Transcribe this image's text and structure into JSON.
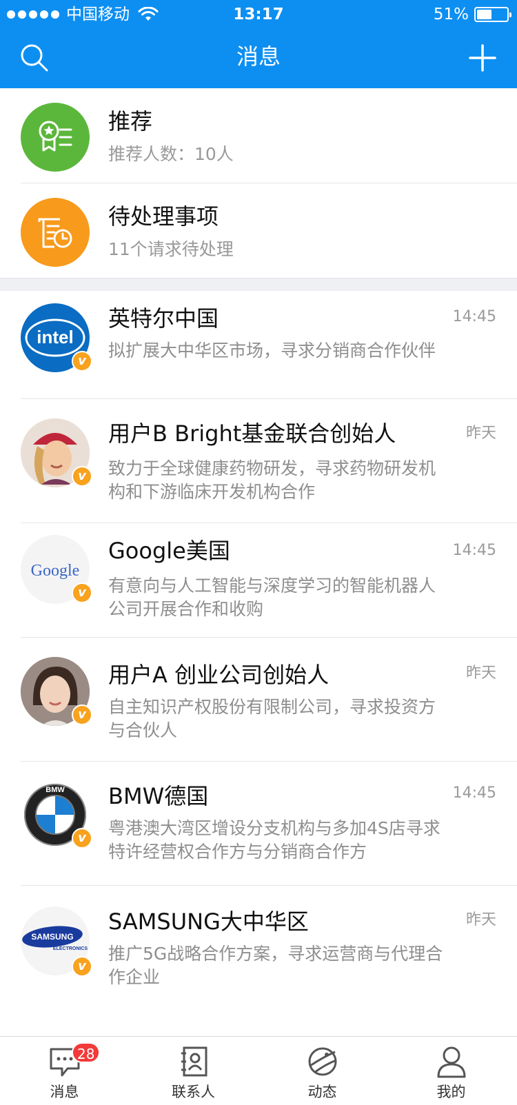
{
  "status_bar": {
    "carrier": "中国移动",
    "time": "13:17",
    "battery": "51%"
  },
  "nav": {
    "title": "消息",
    "icons": [
      "search-icon",
      "plus-icon"
    ]
  },
  "featured": [
    {
      "title": "推荐",
      "subtitle": "推荐人数：10人",
      "icon": "award-icon",
      "color": "#5bb73b"
    },
    {
      "title": "待处理事项",
      "subtitle": "11个请求待处理",
      "icon": "pending-doc-icon",
      "color": "#f89a1b"
    }
  ],
  "messages": [
    {
      "name": "英特尔中国",
      "time": "14:45",
      "preview": "拟扩展大中华区市场，寻求分销商合作伙伴",
      "avatar": "intel-logo",
      "verified_badge": "v"
    },
    {
      "name": "用户B   Bright基金联合创始人",
      "time": "昨天",
      "preview": "致力于全球健康药物研发，寻求药物研发机构和下游临床开发机构合作",
      "avatar": "user-b-photo",
      "verified_badge": "v"
    },
    {
      "name": "Google美国",
      "time": "14:45",
      "preview": "有意向与人工智能与深度学习的智能机器人公司开展合作和收购",
      "avatar": "google-logo",
      "verified_badge": "v"
    },
    {
      "name": "用户A   创业公司创始人",
      "time": "昨天",
      "preview": "自主知识产权股份有限制公司，寻求投资方与合伙人",
      "avatar": "user-a-photo",
      "verified_badge": "v"
    },
    {
      "name": "BMW德国",
      "time": "14:45",
      "preview": "粤港澳大湾区增设分支机构与多加4S店寻求特许经营权合作方与分销商合作方",
      "avatar": "bmw-logo",
      "verified_badge": "v"
    },
    {
      "name": "SAMSUNG大中华区",
      "time": "昨天",
      "preview": "推广5G战略合作方案，寻求运营商与代理合作企业",
      "avatar": "samsung-logo",
      "verified_badge": "v"
    }
  ],
  "tabbar": {
    "items": [
      {
        "label": "消息",
        "icon": "chat-icon",
        "badge": "28"
      },
      {
        "label": "联系人",
        "icon": "contacts-icon"
      },
      {
        "label": "动态",
        "icon": "planet-icon"
      },
      {
        "label": "我的",
        "icon": "profile-icon"
      }
    ]
  },
  "colors": {
    "header": "#0d8ff2",
    "badge": "#f23a3a",
    "verified": "#f8a21e"
  },
  "logos": {
    "intel": "intel",
    "google": "Google",
    "bmw": "BMW",
    "samsung": "SAMSUNG",
    "samsung_sub": "ELECTRONICS"
  }
}
